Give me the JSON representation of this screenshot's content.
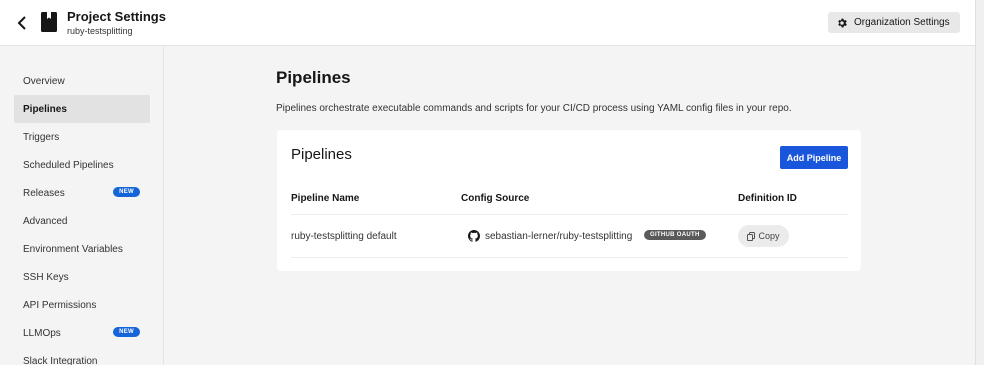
{
  "header": {
    "title": "Project Settings",
    "subtitle": "ruby-testsplitting",
    "org_settings_label": "Organization Settings"
  },
  "sidebar": {
    "items": [
      {
        "label": "Overview"
      },
      {
        "label": "Pipelines",
        "active": true
      },
      {
        "label": "Triggers"
      },
      {
        "label": "Scheduled Pipelines"
      },
      {
        "label": "Releases",
        "badge": "NEW"
      },
      {
        "label": "Advanced"
      },
      {
        "label": "Environment Variables"
      },
      {
        "label": "SSH Keys"
      },
      {
        "label": "API Permissions"
      },
      {
        "label": "LLMOps",
        "badge": "NEW"
      },
      {
        "label": "Slack Integration"
      }
    ]
  },
  "main": {
    "title": "Pipelines",
    "description": "Pipelines orchestrate executable commands and scripts for your CI/CD process using YAML config files in your repo.",
    "card": {
      "title": "Pipelines",
      "add_button": "Add Pipeline",
      "columns": [
        "Pipeline Name",
        "Config Source",
        "Definition ID"
      ],
      "rows": [
        {
          "name": "ruby-testsplitting default",
          "source": "sebastian-lerner/ruby-testsplitting",
          "source_badge": "GITHUB OAUTH",
          "copy_label": "Copy"
        }
      ]
    }
  },
  "colors": {
    "accent": "#1a56db",
    "badge": "#1565d8",
    "background": "#f4f4f4"
  },
  "icons": [
    "back-arrow-icon",
    "project-book-icon",
    "gear-icon",
    "github-icon",
    "copy-icon"
  ]
}
